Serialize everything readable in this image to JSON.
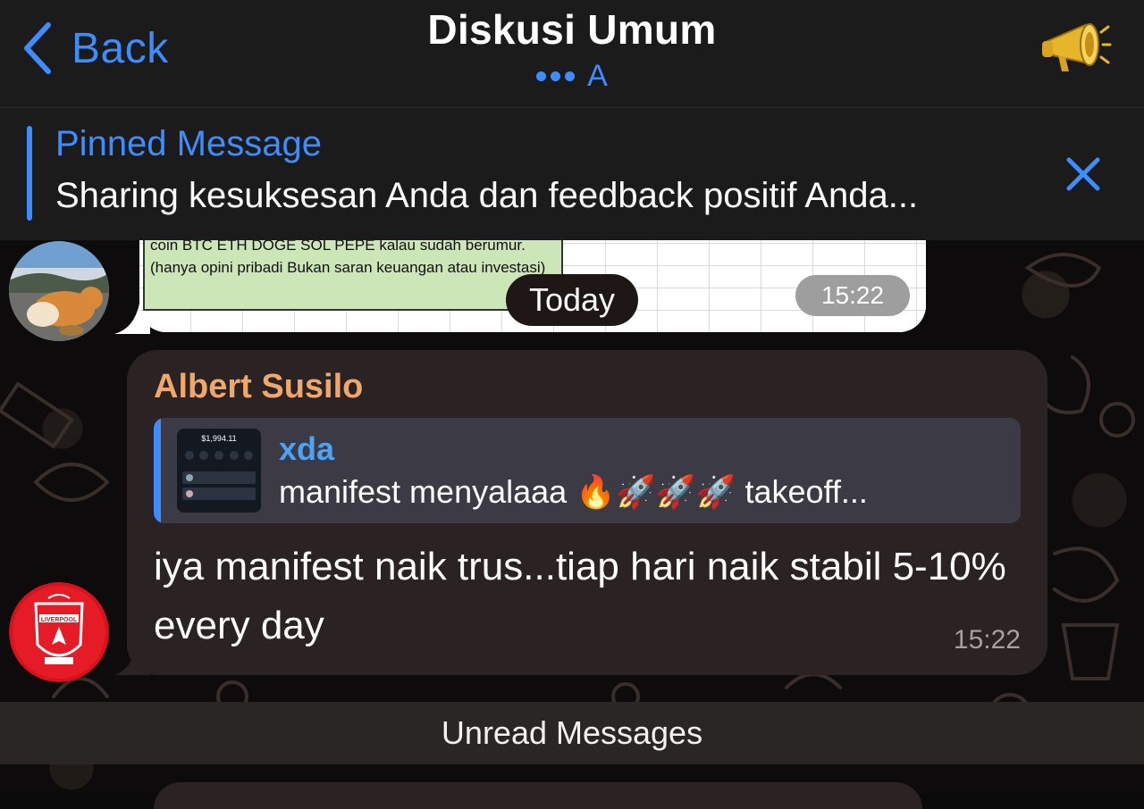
{
  "header": {
    "back_label": "Back",
    "title": "Diskusi Umum",
    "subtitle": "A",
    "icons": {
      "back": "chevron-left-icon",
      "typing": "typing-dots-icon",
      "megaphone": "megaphone-icon"
    }
  },
  "pinned": {
    "label": "Pinned Message",
    "text": "Sharing kesuksesan Anda dan feedback positif Anda...",
    "close_icon": "close-icon"
  },
  "previous_message": {
    "image_text": "coin BTC ETH DOGE SOL PEPE kalau sudah berumur. (hanya opini pribadi  Bukan saran keuangan atau investasi)",
    "time": "15:22"
  },
  "date_separator": "Today",
  "message": {
    "sender": "Albert Susilo",
    "reply": {
      "name": "xda",
      "text": "manifest menyalaaa 🔥🚀🚀🚀 takeoff...",
      "thumb_amount": "$1,994.11"
    },
    "body": "iya manifest naik trus...tiap hari naik stabil 5-10% every day",
    "time": "15:22",
    "avatar_badge": "LIVERPOOL"
  },
  "unread_label": "Unread Messages",
  "colors": {
    "accent": "#3f8cff",
    "sender_name": "#f0a76b",
    "reply_name": "#4ea2f3",
    "bubble": "#2a2223",
    "header_bg": "#1b1b1c"
  }
}
